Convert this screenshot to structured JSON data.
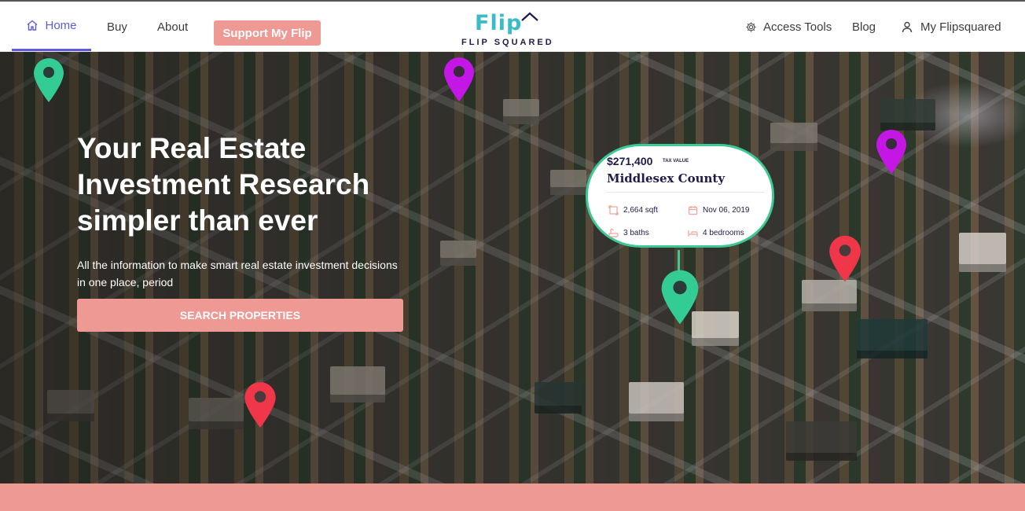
{
  "nav": {
    "home": "Home",
    "buy": "Buy",
    "about": "About",
    "support": "Support My Flip",
    "access_tools": "Access Tools",
    "blog": "Blog",
    "account": "My Flipsquared"
  },
  "logo": {
    "word": "Flip",
    "sub": "FLIP SQUARED"
  },
  "hero": {
    "title": "Your Real Estate Investment Research simpler than ever",
    "subtitle": "All the information to make smart real estate investment decisions in one place, period",
    "cta": "SEARCH PROPERTIES"
  },
  "property_card": {
    "value": "$271,400",
    "value_label": "TAX VALUE",
    "county": "Middlesex County",
    "sqft": "2,664 sqft",
    "date": "Nov 06, 2019",
    "baths": "3 baths",
    "bedrooms": "4 bedrooms"
  },
  "colors": {
    "accent": "#5b5bdc",
    "brand_pink": "#ef9995",
    "pin_green": "#33cc95",
    "pin_magenta": "#c417e6",
    "pin_red": "#f0374a",
    "logo_teal": "#3bbbc6",
    "navy": "#1e1b4a"
  }
}
